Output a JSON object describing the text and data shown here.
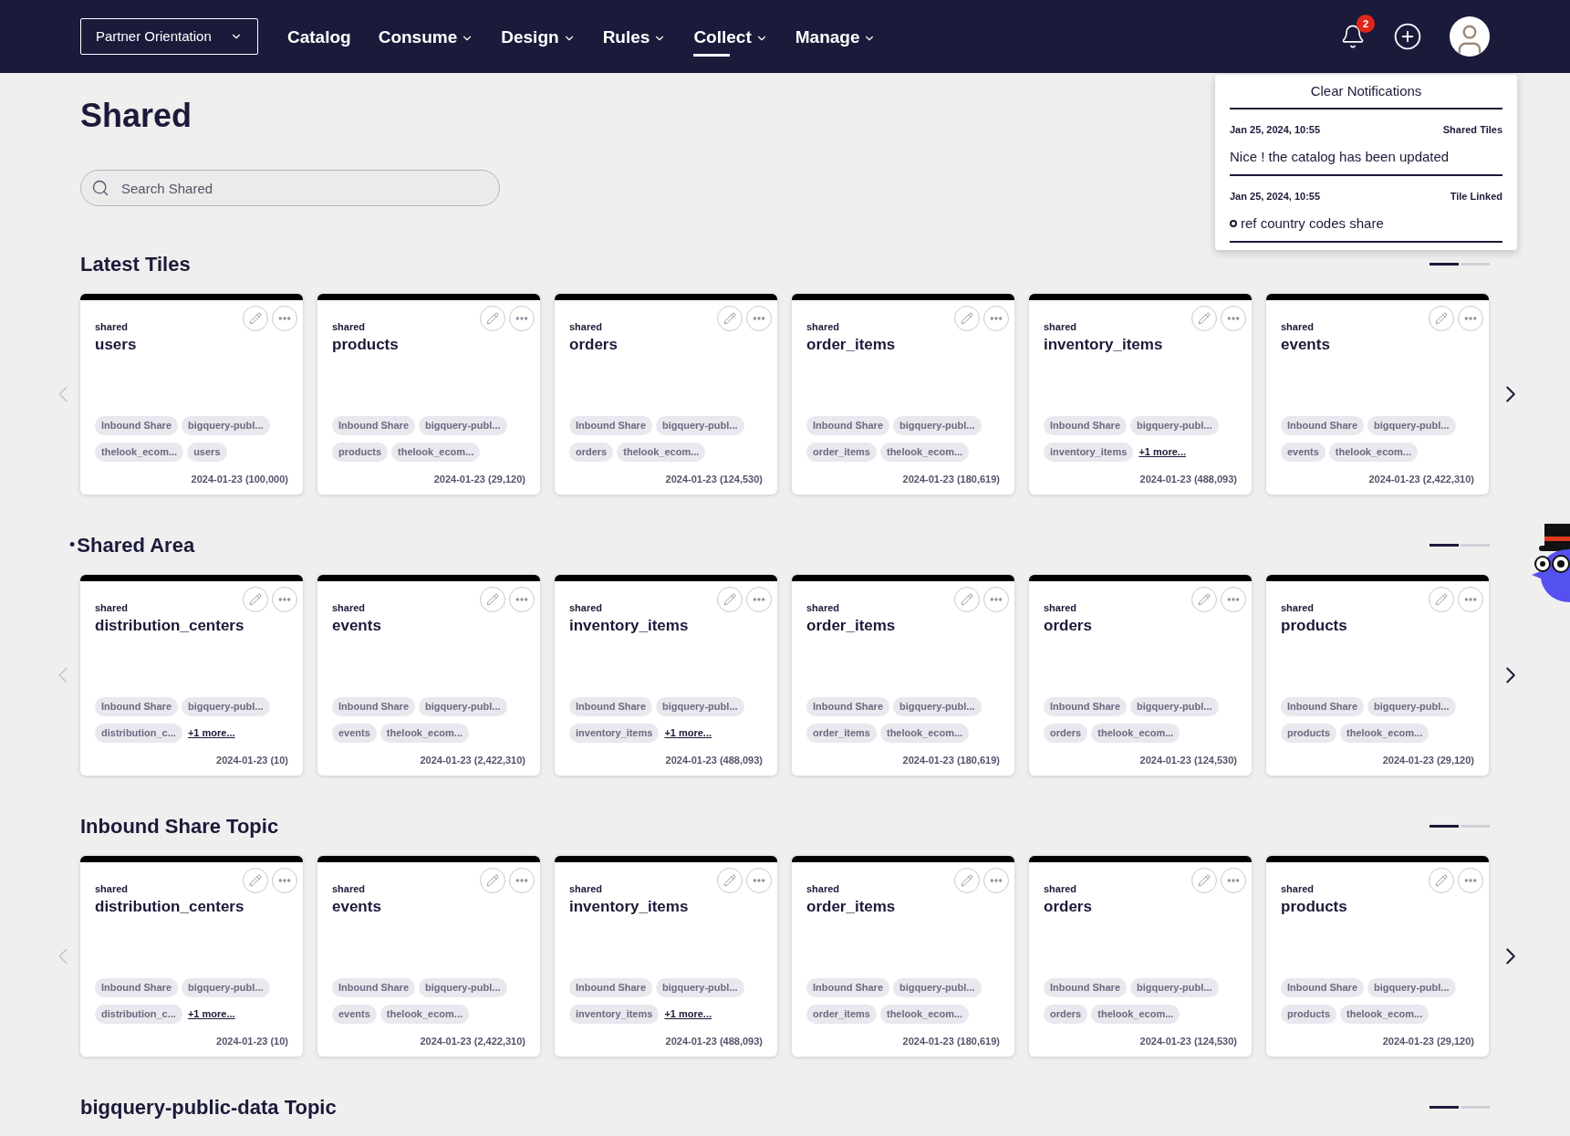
{
  "nav": {
    "workspace": "Partner Orientation",
    "items": [
      {
        "label": "Catalog",
        "has_menu": false,
        "selected": false
      },
      {
        "label": "Consume",
        "has_menu": true,
        "selected": false
      },
      {
        "label": "Design",
        "has_menu": true,
        "selected": false
      },
      {
        "label": "Rules",
        "has_menu": true,
        "selected": false
      },
      {
        "label": "Collect",
        "has_menu": true,
        "selected": true
      },
      {
        "label": "Manage",
        "has_menu": true,
        "selected": false
      }
    ],
    "notification_count": "2"
  },
  "notifications": {
    "clear_label": "Clear Notifications",
    "items": [
      {
        "time": "Jan 25, 2024, 10:55",
        "category": "Shared Tiles",
        "text": "Nice ! the catalog has been updated",
        "kind": "plain"
      },
      {
        "time": "Jan 25, 2024, 10:55",
        "category": "Tile Linked",
        "text": "ref country codes share",
        "kind": "linked"
      }
    ]
  },
  "page": {
    "title": "Shared",
    "search": {
      "placeholder": "Search Shared"
    }
  },
  "sections": [
    {
      "title": "Latest Tiles",
      "pager": [
        {
          "selected": true
        },
        {
          "selected": false
        }
      ],
      "cards": [
        {
          "label": "shared",
          "title": "users",
          "tag_rows": [
            [
              "Inbound Share",
              "bigquery-publ..."
            ],
            [
              "thelook_ecom...",
              "users"
            ]
          ],
          "footer": "2024-01-23 (100,000)"
        },
        {
          "label": "shared",
          "title": "products",
          "tag_rows": [
            [
              "Inbound Share",
              "bigquery-publ..."
            ],
            [
              "products",
              "thelook_ecom..."
            ]
          ],
          "footer": "2024-01-23 (29,120)"
        },
        {
          "label": "shared",
          "title": "orders",
          "tag_rows": [
            [
              "Inbound Share",
              "bigquery-publ..."
            ],
            [
              "orders",
              "thelook_ecom..."
            ]
          ],
          "footer": "2024-01-23 (124,530)"
        },
        {
          "label": "shared",
          "title": "order_items",
          "tag_rows": [
            [
              "Inbound Share",
              "bigquery-publ..."
            ],
            [
              "order_items",
              "thelook_ecom..."
            ]
          ],
          "footer": "2024-01-23 (180,619)"
        },
        {
          "label": "shared",
          "title": "inventory_items",
          "tag_rows": [
            [
              "Inbound Share",
              "bigquery-publ..."
            ],
            [
              "inventory_items"
            ]
          ],
          "more": "+1 more...",
          "footer": "2024-01-23 (488,093)"
        },
        {
          "label": "shared",
          "title": "events",
          "tag_rows": [
            [
              "Inbound Share",
              "bigquery-publ..."
            ],
            [
              "events",
              "thelook_ecom..."
            ]
          ],
          "footer": "2024-01-23 (2,422,310)"
        }
      ]
    },
    {
      "title": "Shared Area",
      "marker": "•",
      "pager": [
        {
          "selected": true
        },
        {
          "selected": false
        }
      ],
      "cards": [
        {
          "label": "shared",
          "title": "distribution_centers",
          "tag_rows": [
            [
              "Inbound Share",
              "bigquery-publ..."
            ],
            [
              "distribution_c..."
            ]
          ],
          "more": "+1 more...",
          "footer": "2024-01-23 (10)"
        },
        {
          "label": "shared",
          "title": "events",
          "tag_rows": [
            [
              "Inbound Share",
              "bigquery-publ..."
            ],
            [
              "events",
              "thelook_ecom..."
            ]
          ],
          "footer": "2024-01-23 (2,422,310)"
        },
        {
          "label": "shared",
          "title": "inventory_items",
          "tag_rows": [
            [
              "Inbound Share",
              "bigquery-publ..."
            ],
            [
              "inventory_items"
            ]
          ],
          "more": "+1 more...",
          "footer": "2024-01-23 (488,093)"
        },
        {
          "label": "shared",
          "title": "order_items",
          "tag_rows": [
            [
              "Inbound Share",
              "bigquery-publ..."
            ],
            [
              "order_items",
              "thelook_ecom..."
            ]
          ],
          "footer": "2024-01-23 (180,619)"
        },
        {
          "label": "shared",
          "title": "orders",
          "tag_rows": [
            [
              "Inbound Share",
              "bigquery-publ..."
            ],
            [
              "orders",
              "thelook_ecom..."
            ]
          ],
          "footer": "2024-01-23 (124,530)"
        },
        {
          "label": "shared",
          "title": "products",
          "tag_rows": [
            [
              "Inbound Share",
              "bigquery-publ..."
            ],
            [
              "products",
              "thelook_ecom..."
            ]
          ],
          "footer": "2024-01-23 (29,120)"
        }
      ]
    },
    {
      "title": "Inbound Share Topic",
      "pager": [
        {
          "selected": true
        },
        {
          "selected": false
        }
      ],
      "cards": [
        {
          "label": "shared",
          "title": "distribution_centers",
          "tag_rows": [
            [
              "Inbound Share",
              "bigquery-publ..."
            ],
            [
              "distribution_c..."
            ]
          ],
          "more": "+1 more...",
          "footer": "2024-01-23 (10)"
        },
        {
          "label": "shared",
          "title": "events",
          "tag_rows": [
            [
              "Inbound Share",
              "bigquery-publ..."
            ],
            [
              "events",
              "thelook_ecom..."
            ]
          ],
          "footer": "2024-01-23 (2,422,310)"
        },
        {
          "label": "shared",
          "title": "inventory_items",
          "tag_rows": [
            [
              "Inbound Share",
              "bigquery-publ..."
            ],
            [
              "inventory_items"
            ]
          ],
          "more": "+1 more...",
          "footer": "2024-01-23 (488,093)"
        },
        {
          "label": "shared",
          "title": "order_items",
          "tag_rows": [
            [
              "Inbound Share",
              "bigquery-publ..."
            ],
            [
              "order_items",
              "thelook_ecom..."
            ]
          ],
          "footer": "2024-01-23 (180,619)"
        },
        {
          "label": "shared",
          "title": "orders",
          "tag_rows": [
            [
              "Inbound Share",
              "bigquery-publ..."
            ],
            [
              "orders",
              "thelook_ecom..."
            ]
          ],
          "footer": "2024-01-23 (124,530)"
        },
        {
          "label": "shared",
          "title": "products",
          "tag_rows": [
            [
              "Inbound Share",
              "bigquery-publ..."
            ],
            [
              "products",
              "thelook_ecom..."
            ]
          ],
          "footer": "2024-01-23 (29,120)"
        }
      ]
    },
    {
      "title": "bigquery-public-data Topic",
      "pager": [
        {
          "selected": true
        },
        {
          "selected": false
        }
      ]
    }
  ]
}
